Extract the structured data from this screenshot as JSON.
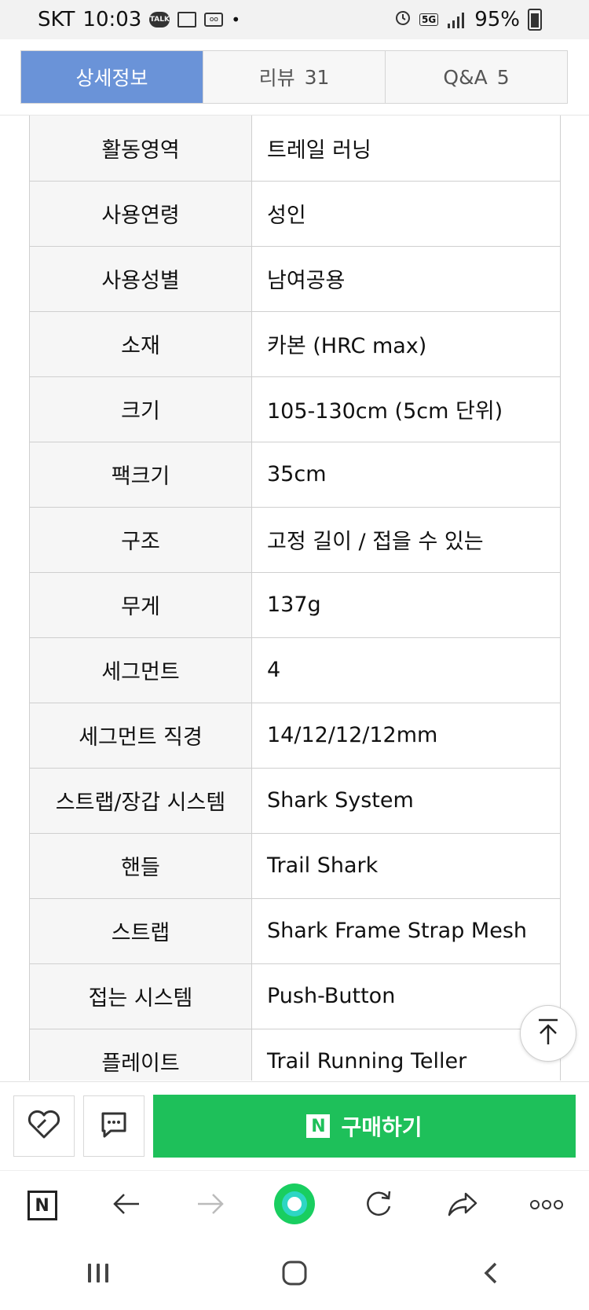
{
  "status_bar": {
    "carrier": "SKT",
    "time": "10:03",
    "talk_badge": "TALK",
    "network": "5G",
    "battery": "95%"
  },
  "tabs": [
    {
      "label": "상세정보",
      "count": ""
    },
    {
      "label": "리뷰",
      "count": "31"
    },
    {
      "label": "Q&A",
      "count": "5"
    }
  ],
  "specs": [
    {
      "key": "활동영역",
      "value": "트레일 러닝"
    },
    {
      "key": "사용연령",
      "value": "성인"
    },
    {
      "key": "사용성별",
      "value": "남여공용"
    },
    {
      "key": "소재",
      "value": "카본 (HRC max)"
    },
    {
      "key": "크기",
      "value": "105-130cm (5cm 단위)"
    },
    {
      "key": "팩크기",
      "value": "35cm"
    },
    {
      "key": "구조",
      "value": "고정 길이 / 접을 수 있는"
    },
    {
      "key": "무게",
      "value": "137g"
    },
    {
      "key": "세그먼트",
      "value": "4"
    },
    {
      "key": "세그먼트 직경",
      "value": "14/12/12/12mm"
    },
    {
      "key": "스트랩/장갑 시스템",
      "value": "Shark System"
    },
    {
      "key": "핸들",
      "value": "Trail Shark"
    },
    {
      "key": "스트랩",
      "value": "Shark Frame Strap Mesh"
    },
    {
      "key": "접는 시스템",
      "value": "Push-Button"
    },
    {
      "key": "플레이트",
      "value": "Trail Running Teller"
    }
  ],
  "buy_bar": {
    "npay_mark": "N",
    "buy_label": "구매하기",
    "buy_color": "#1ec05a"
  },
  "browser_toolbar": {
    "home_mark": "N",
    "icons": [
      "naver-home-icon",
      "back-arrow-icon",
      "forward-arrow-icon",
      "green-dot-icon",
      "refresh-icon",
      "share-icon",
      "more-icon"
    ]
  },
  "colors": {
    "active_tab": "#6a93d8",
    "accent_green": "#1ec05a"
  }
}
